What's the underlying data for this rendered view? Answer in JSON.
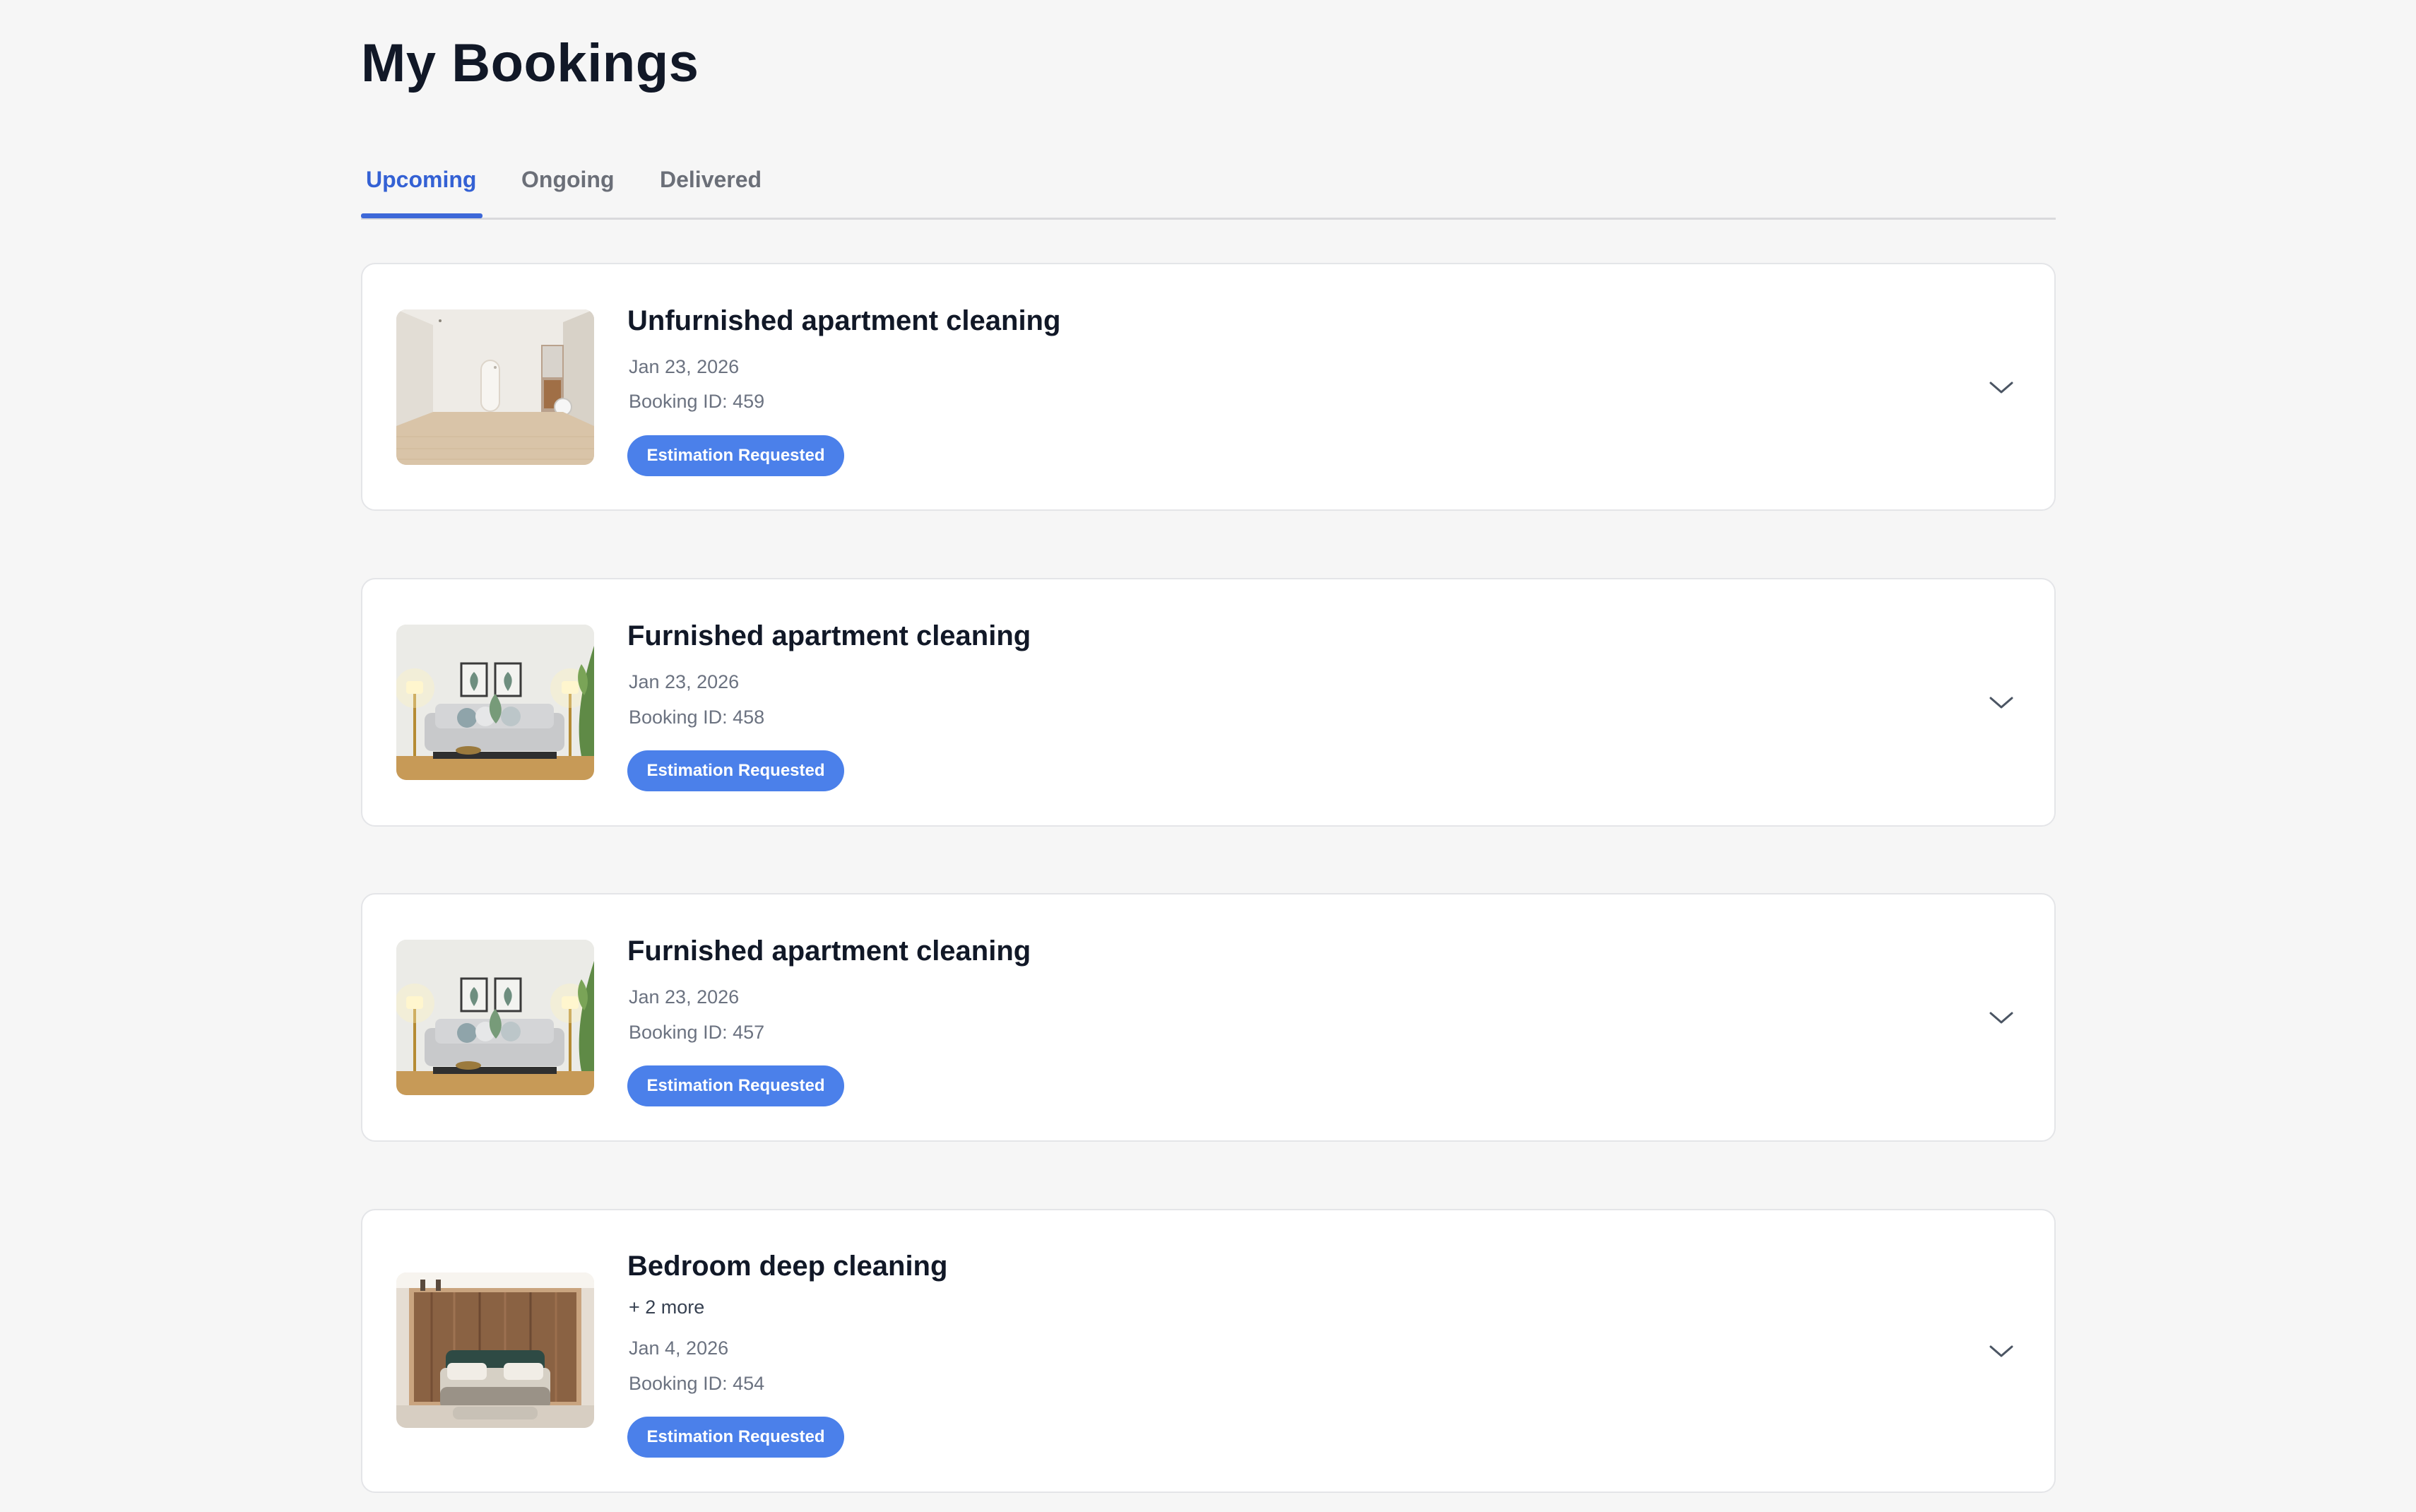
{
  "page": {
    "title": "My Bookings"
  },
  "tabs": [
    {
      "label": "Upcoming",
      "active": true
    },
    {
      "label": "Ongoing",
      "active": false
    },
    {
      "label": "Delivered",
      "active": false
    }
  ],
  "bookings": [
    {
      "title": "Unfurnished apartment cleaning",
      "date": "Jan 23, 2026",
      "booking_id": "Booking ID: 459",
      "status": "Estimation Requested",
      "image": "empty-apartment-photo",
      "expand_icon": "chevron-down-icon"
    },
    {
      "title": "Furnished apartment cleaning",
      "date": "Jan 23, 2026",
      "booking_id": "Booking ID: 458",
      "status": "Estimation Requested",
      "image": "furnished-living-room-photo",
      "expand_icon": "chevron-down-icon"
    },
    {
      "title": "Furnished apartment cleaning",
      "date": "Jan 23, 2026",
      "booking_id": "Booking ID: 457",
      "status": "Estimation Requested",
      "image": "furnished-living-room-photo",
      "expand_icon": "chevron-down-icon"
    },
    {
      "title": "Bedroom deep cleaning",
      "more": "+ 2 more",
      "date": "Jan 4, 2026",
      "booking_id": "Booking ID: 454",
      "status": "Estimation Requested",
      "image": "bedroom-photo",
      "expand_icon": "chevron-down-icon"
    }
  ],
  "colors": {
    "accent": "#3d68d8",
    "badge": "#4b80ea",
    "page_background": "#f6f6f6",
    "card_background": "#ffffff"
  }
}
